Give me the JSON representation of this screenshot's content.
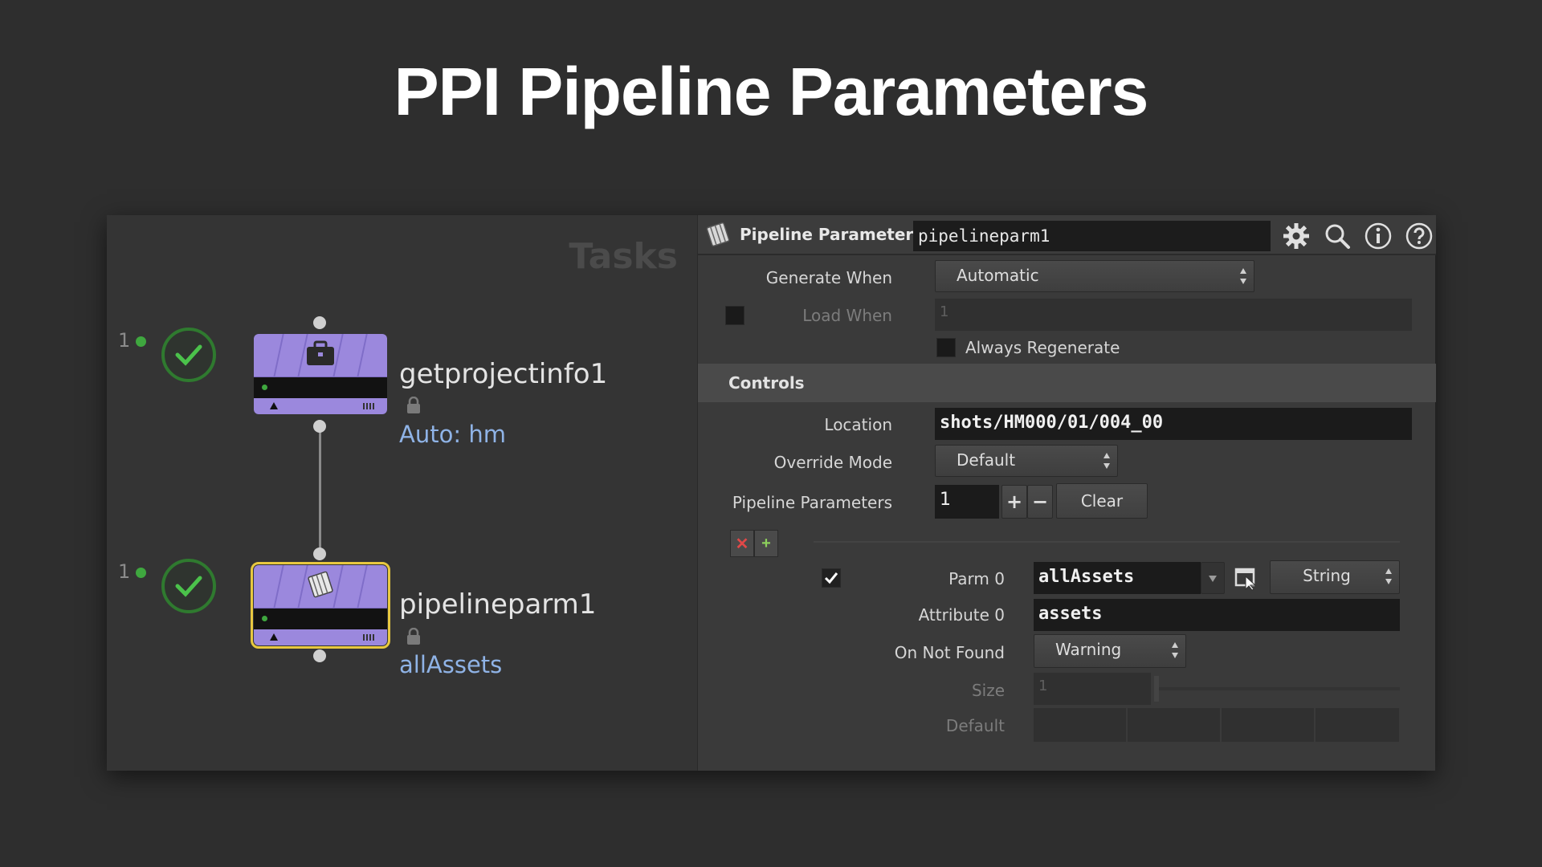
{
  "slide": {
    "title": "PPI Pipeline Parameters"
  },
  "network": {
    "tasks_label": "Tasks",
    "nodes": [
      {
        "count": "1",
        "name": "getprojectinfo1",
        "sub": "Auto: hm",
        "icon": "briefcase-icon",
        "selected": false
      },
      {
        "count": "1",
        "name": "pipelineparm1",
        "sub": "allAssets",
        "icon": "scroll-icon",
        "selected": true
      }
    ],
    "colors": {
      "node": "#9b88dd",
      "status_green": "#3fa73f",
      "selected_outline": "#e8c840",
      "sublabel": "#8fb3e6"
    }
  },
  "params": {
    "type_label": "Pipeline Parameters",
    "node_name": "pipelineparm1",
    "header_icons": [
      "gear-icon",
      "search-icon",
      "info-icon",
      "help-icon"
    ],
    "generate_when": {
      "label": "Generate When",
      "value": "Automatic"
    },
    "load_when": {
      "label": "Load When",
      "value": "1"
    },
    "always_regenerate": {
      "label": "Always Regenerate"
    },
    "controls_section": "Controls",
    "location": {
      "label": "Location",
      "value": "shots/HM000/01/004_00"
    },
    "override_mode": {
      "label": "Override Mode",
      "value": "Default"
    },
    "pipeline_parameters": {
      "label": "Pipeline Parameters",
      "value": "1",
      "plus": "+",
      "minus": "−",
      "clear": "Clear"
    },
    "parm0": {
      "label": "Parm 0",
      "value": "allAssets",
      "type": "String"
    },
    "attribute0": {
      "label": "Attribute 0",
      "value": "assets"
    },
    "on_not_found": {
      "label": "On Not Found",
      "value": "Warning"
    },
    "size": {
      "label": "Size",
      "value": "1"
    },
    "default": {
      "label": "Default"
    }
  }
}
